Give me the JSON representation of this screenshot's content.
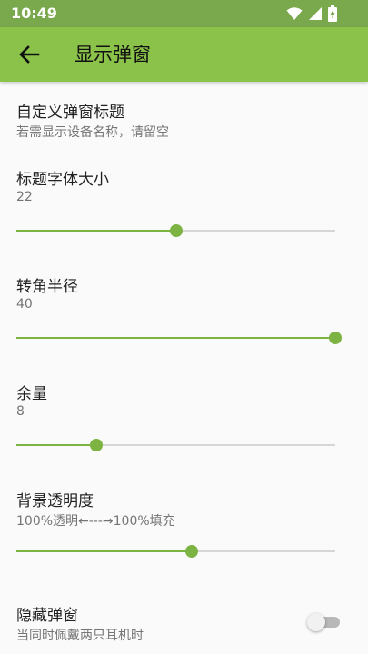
{
  "status_bar": {
    "time": "10:49",
    "icons": [
      "wifi-icon",
      "cell-signal-icon",
      "battery-charging-icon"
    ]
  },
  "app_bar": {
    "title": "显示弹窗",
    "back_icon": "arrow-back-icon"
  },
  "colors": {
    "status_bar": "#7aa84d",
    "app_bar": "#8bc34a",
    "accent": "#7cb342",
    "background": "#fafafa"
  },
  "settings": {
    "custom_title": {
      "title": "自定义弹窗标题",
      "summary": "若需显示设备名称，请留空"
    },
    "title_font_size": {
      "title": "标题字体大小",
      "value": "22",
      "slider_fraction": 0.5
    },
    "corner_radius": {
      "title": "转角半径",
      "value": "40",
      "slider_fraction": 1.0
    },
    "margin": {
      "title": "余量",
      "value": "8",
      "slider_fraction": 0.25
    },
    "bg_opacity": {
      "title": "背景透明度",
      "summary": "100%透明←---→100%填充",
      "slider_fraction": 0.55
    },
    "hide_popup": {
      "title": "隐藏弹窗",
      "summary": "当同时佩戴两只耳机时",
      "enabled": false
    }
  }
}
